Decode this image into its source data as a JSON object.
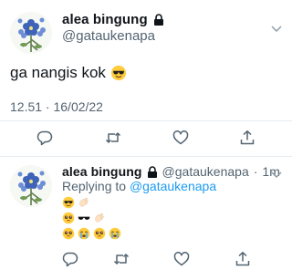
{
  "main_tweet": {
    "display_name": "alea bingung",
    "handle": "@gataukenapa",
    "text": "ga nangis kok",
    "timestamp": "12.51 · 16/02/22"
  },
  "reply_tweet": {
    "display_name": "alea bingung",
    "handle": "@gataukenapa",
    "time_ago": "1m",
    "replying_to_prefix": "Replying to",
    "replying_to_handle": "@gataukenapa"
  },
  "icons": [
    "lock-icon",
    "chevron-down-icon",
    "reply-icon",
    "retweet-icon",
    "like-icon",
    "share-icon",
    "sunglasses-face-emoji",
    "wave-hand-emoji",
    "sunglasses-emoji",
    "pleading-face-emoji",
    "sob-emoji"
  ],
  "colors": {
    "accent": "#1d9bf0",
    "secondary_text": "#536471",
    "divider": "#e6ecf0",
    "primary_text": "#0f1419"
  }
}
